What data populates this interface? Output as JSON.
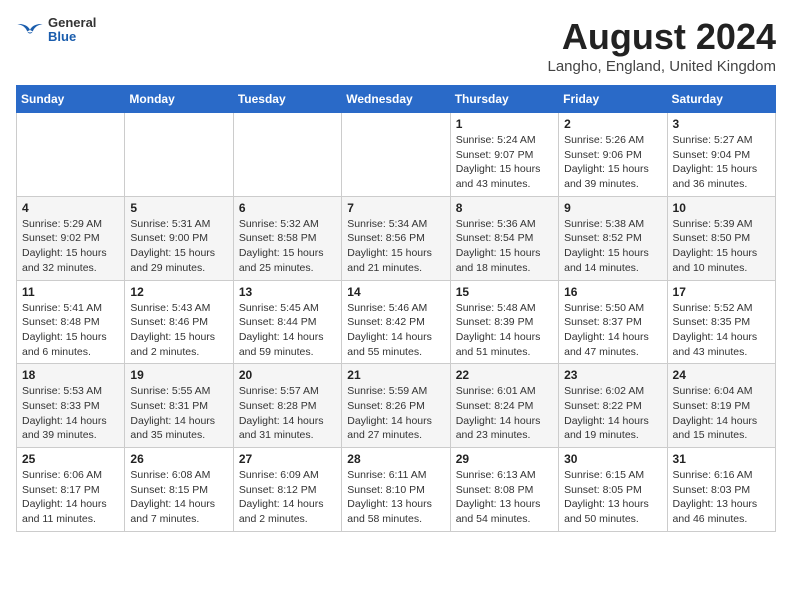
{
  "header": {
    "logo_general": "General",
    "logo_blue": "Blue",
    "month_year": "August 2024",
    "location": "Langho, England, United Kingdom"
  },
  "weekdays": [
    "Sunday",
    "Monday",
    "Tuesday",
    "Wednesday",
    "Thursday",
    "Friday",
    "Saturday"
  ],
  "weeks": [
    [
      {
        "day": "",
        "sunrise": "",
        "sunset": "",
        "daylight": ""
      },
      {
        "day": "",
        "sunrise": "",
        "sunset": "",
        "daylight": ""
      },
      {
        "day": "",
        "sunrise": "",
        "sunset": "",
        "daylight": ""
      },
      {
        "day": "",
        "sunrise": "",
        "sunset": "",
        "daylight": ""
      },
      {
        "day": "1",
        "sunrise": "Sunrise: 5:24 AM",
        "sunset": "Sunset: 9:07 PM",
        "daylight": "Daylight: 15 hours and 43 minutes."
      },
      {
        "day": "2",
        "sunrise": "Sunrise: 5:26 AM",
        "sunset": "Sunset: 9:06 PM",
        "daylight": "Daylight: 15 hours and 39 minutes."
      },
      {
        "day": "3",
        "sunrise": "Sunrise: 5:27 AM",
        "sunset": "Sunset: 9:04 PM",
        "daylight": "Daylight: 15 hours and 36 minutes."
      }
    ],
    [
      {
        "day": "4",
        "sunrise": "Sunrise: 5:29 AM",
        "sunset": "Sunset: 9:02 PM",
        "daylight": "Daylight: 15 hours and 32 minutes."
      },
      {
        "day": "5",
        "sunrise": "Sunrise: 5:31 AM",
        "sunset": "Sunset: 9:00 PM",
        "daylight": "Daylight: 15 hours and 29 minutes."
      },
      {
        "day": "6",
        "sunrise": "Sunrise: 5:32 AM",
        "sunset": "Sunset: 8:58 PM",
        "daylight": "Daylight: 15 hours and 25 minutes."
      },
      {
        "day": "7",
        "sunrise": "Sunrise: 5:34 AM",
        "sunset": "Sunset: 8:56 PM",
        "daylight": "Daylight: 15 hours and 21 minutes."
      },
      {
        "day": "8",
        "sunrise": "Sunrise: 5:36 AM",
        "sunset": "Sunset: 8:54 PM",
        "daylight": "Daylight: 15 hours and 18 minutes."
      },
      {
        "day": "9",
        "sunrise": "Sunrise: 5:38 AM",
        "sunset": "Sunset: 8:52 PM",
        "daylight": "Daylight: 15 hours and 14 minutes."
      },
      {
        "day": "10",
        "sunrise": "Sunrise: 5:39 AM",
        "sunset": "Sunset: 8:50 PM",
        "daylight": "Daylight: 15 hours and 10 minutes."
      }
    ],
    [
      {
        "day": "11",
        "sunrise": "Sunrise: 5:41 AM",
        "sunset": "Sunset: 8:48 PM",
        "daylight": "Daylight: 15 hours and 6 minutes."
      },
      {
        "day": "12",
        "sunrise": "Sunrise: 5:43 AM",
        "sunset": "Sunset: 8:46 PM",
        "daylight": "Daylight: 15 hours and 2 minutes."
      },
      {
        "day": "13",
        "sunrise": "Sunrise: 5:45 AM",
        "sunset": "Sunset: 8:44 PM",
        "daylight": "Daylight: 14 hours and 59 minutes."
      },
      {
        "day": "14",
        "sunrise": "Sunrise: 5:46 AM",
        "sunset": "Sunset: 8:42 PM",
        "daylight": "Daylight: 14 hours and 55 minutes."
      },
      {
        "day": "15",
        "sunrise": "Sunrise: 5:48 AM",
        "sunset": "Sunset: 8:39 PM",
        "daylight": "Daylight: 14 hours and 51 minutes."
      },
      {
        "day": "16",
        "sunrise": "Sunrise: 5:50 AM",
        "sunset": "Sunset: 8:37 PM",
        "daylight": "Daylight: 14 hours and 47 minutes."
      },
      {
        "day": "17",
        "sunrise": "Sunrise: 5:52 AM",
        "sunset": "Sunset: 8:35 PM",
        "daylight": "Daylight: 14 hours and 43 minutes."
      }
    ],
    [
      {
        "day": "18",
        "sunrise": "Sunrise: 5:53 AM",
        "sunset": "Sunset: 8:33 PM",
        "daylight": "Daylight: 14 hours and 39 minutes."
      },
      {
        "day": "19",
        "sunrise": "Sunrise: 5:55 AM",
        "sunset": "Sunset: 8:31 PM",
        "daylight": "Daylight: 14 hours and 35 minutes."
      },
      {
        "day": "20",
        "sunrise": "Sunrise: 5:57 AM",
        "sunset": "Sunset: 8:28 PM",
        "daylight": "Daylight: 14 hours and 31 minutes."
      },
      {
        "day": "21",
        "sunrise": "Sunrise: 5:59 AM",
        "sunset": "Sunset: 8:26 PM",
        "daylight": "Daylight: 14 hours and 27 minutes."
      },
      {
        "day": "22",
        "sunrise": "Sunrise: 6:01 AM",
        "sunset": "Sunset: 8:24 PM",
        "daylight": "Daylight: 14 hours and 23 minutes."
      },
      {
        "day": "23",
        "sunrise": "Sunrise: 6:02 AM",
        "sunset": "Sunset: 8:22 PM",
        "daylight": "Daylight: 14 hours and 19 minutes."
      },
      {
        "day": "24",
        "sunrise": "Sunrise: 6:04 AM",
        "sunset": "Sunset: 8:19 PM",
        "daylight": "Daylight: 14 hours and 15 minutes."
      }
    ],
    [
      {
        "day": "25",
        "sunrise": "Sunrise: 6:06 AM",
        "sunset": "Sunset: 8:17 PM",
        "daylight": "Daylight: 14 hours and 11 minutes."
      },
      {
        "day": "26",
        "sunrise": "Sunrise: 6:08 AM",
        "sunset": "Sunset: 8:15 PM",
        "daylight": "Daylight: 14 hours and 7 minutes."
      },
      {
        "day": "27",
        "sunrise": "Sunrise: 6:09 AM",
        "sunset": "Sunset: 8:12 PM",
        "daylight": "Daylight: 14 hours and 2 minutes."
      },
      {
        "day": "28",
        "sunrise": "Sunrise: 6:11 AM",
        "sunset": "Sunset: 8:10 PM",
        "daylight": "Daylight: 13 hours and 58 minutes."
      },
      {
        "day": "29",
        "sunrise": "Sunrise: 6:13 AM",
        "sunset": "Sunset: 8:08 PM",
        "daylight": "Daylight: 13 hours and 54 minutes."
      },
      {
        "day": "30",
        "sunrise": "Sunrise: 6:15 AM",
        "sunset": "Sunset: 8:05 PM",
        "daylight": "Daylight: 13 hours and 50 minutes."
      },
      {
        "day": "31",
        "sunrise": "Sunrise: 6:16 AM",
        "sunset": "Sunset: 8:03 PM",
        "daylight": "Daylight: 13 hours and 46 minutes."
      }
    ]
  ]
}
